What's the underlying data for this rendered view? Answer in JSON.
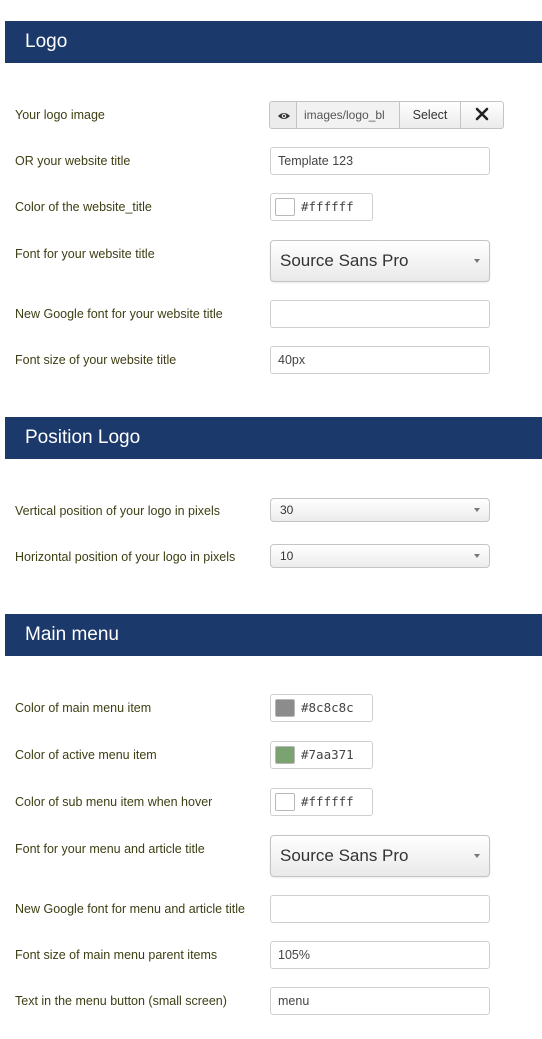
{
  "sections": {
    "logo": {
      "title": "Logo"
    },
    "position": {
      "title": "Position Logo"
    },
    "menu": {
      "title": "Main menu"
    }
  },
  "logo": {
    "image": {
      "label": "Your logo image",
      "path": "images/logo_bl",
      "select_label": "Select",
      "clear_icon": "close-icon",
      "preview_icon": "eye-icon"
    },
    "site_title": {
      "label": "OR your website title",
      "value": "Template 123"
    },
    "title_color": {
      "label": "Color of the website_title",
      "value": "#ffffff",
      "swatch": "#ffffff"
    },
    "title_font": {
      "label": "Font for your website title",
      "value": "Source Sans Pro"
    },
    "google_font": {
      "label": "New Google font for your website title",
      "value": ""
    },
    "font_size": {
      "label": "Font size of your website title",
      "value": "40px"
    }
  },
  "position": {
    "vertical": {
      "label": "Vertical position of your logo in pixels",
      "value": "30"
    },
    "horizontal": {
      "label": "Horizontal position of your logo in pixels",
      "value": "10"
    }
  },
  "menu": {
    "item_color": {
      "label": "Color of main menu item",
      "value": "#8c8c8c",
      "swatch": "#8c8c8c"
    },
    "active_color": {
      "label": "Color of active menu item",
      "value": "#7aa371",
      "swatch": "#7aa371"
    },
    "sub_hover_color": {
      "label": "Color of sub menu item when hover",
      "value": "#ffffff",
      "swatch": "#ffffff"
    },
    "font": {
      "label": "Font for your menu and article title",
      "value": "Source Sans Pro"
    },
    "google_font": {
      "label": "New Google font for menu and article title",
      "value": ""
    },
    "parent_font_size": {
      "label": "Font size of main menu parent items",
      "value": "105%"
    },
    "button_text": {
      "label": "Text in the menu button (small screen)",
      "value": "menu"
    }
  }
}
